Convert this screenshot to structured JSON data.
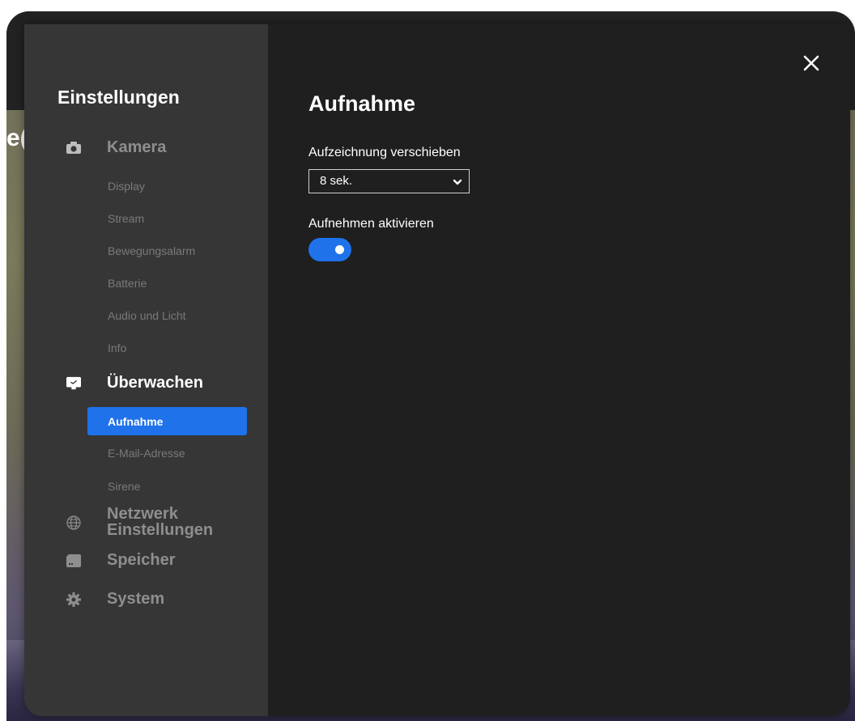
{
  "sidebar": {
    "title": "Einstellungen",
    "groups": {
      "kamera": {
        "label": "Kamera",
        "icon": "camera-icon"
      },
      "ueberwachen": {
        "label": "Überwachen",
        "icon": "monitor-icon"
      },
      "netzwerk": {
        "label_line1": "Netzwerk",
        "label_line2": "Einstellungen",
        "icon": "globe-icon"
      },
      "speicher": {
        "label": "Speicher",
        "icon": "sd-card-icon"
      },
      "system": {
        "label": "System",
        "icon": "gear-icon"
      }
    },
    "kamera_items": [
      "Display",
      "Stream",
      "Bewegungsalarm",
      "Batterie",
      "Audio und Licht",
      "Info"
    ],
    "ueberwachen_items": [
      "Aufnahme",
      "E-Mail-Adresse",
      "Sirene"
    ],
    "active_item": "Aufnahme"
  },
  "main": {
    "title": "Aufnahme",
    "delay_label": "Aufzeichnung verschieben",
    "delay_value": "8 sek.",
    "record_label": "Aufnehmen aktivieren",
    "record_enabled": true,
    "close_icon": "close-icon"
  },
  "background": {
    "partial_text": "e("
  },
  "colors": {
    "accent": "#1f72ea",
    "sidebar_bg": "#363636",
    "content_bg": "#1f1f1f"
  }
}
